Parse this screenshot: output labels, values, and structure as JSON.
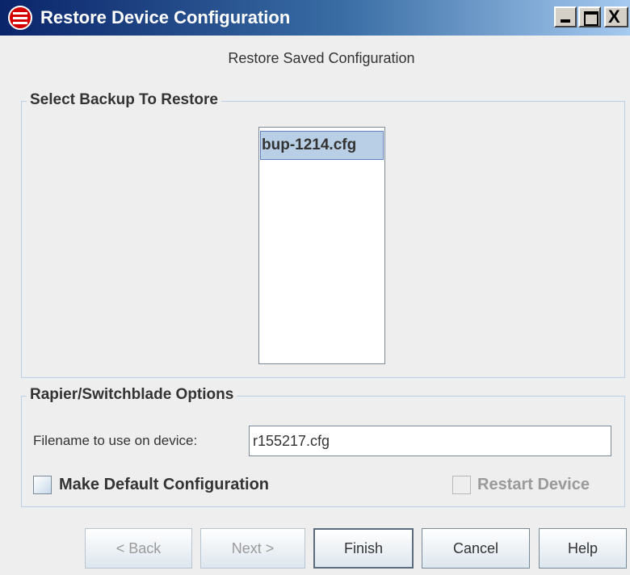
{
  "window": {
    "title": "Restore Device Configuration",
    "controls": {
      "minimize": "_",
      "maximize": "□",
      "close": "X"
    }
  },
  "header": {
    "subtitle": "Restore Saved Configuration"
  },
  "backup_section": {
    "title": "Select Backup To Restore",
    "items": [
      {
        "label": "bup-1214.cfg",
        "selected": true
      }
    ]
  },
  "options_section": {
    "title": "Rapier/Switchblade Options",
    "filename_label": "Filename to use on device:",
    "filename_value": "r155217.cfg",
    "make_default_label": "Make Default Configuration",
    "make_default_checked": false,
    "restart_label": "Restart Device",
    "restart_checked": false,
    "restart_enabled": false
  },
  "buttons": {
    "back": "< Back",
    "next": "Next >",
    "finish": "Finish",
    "cancel": "Cancel",
    "help": "Help"
  },
  "icons": {
    "app": "app-icon"
  },
  "colors": {
    "titlebar_start": "#0a246a",
    "titlebar_end": "#a6caf0",
    "selection": "#b8cfe5",
    "background": "#eeeeee"
  }
}
